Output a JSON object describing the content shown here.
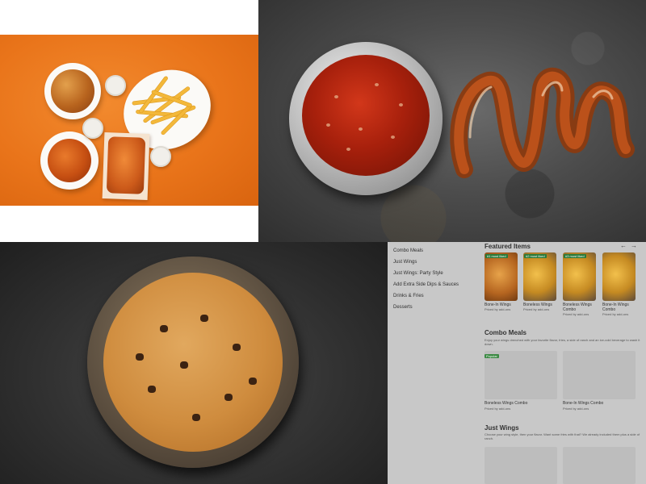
{
  "menu": {
    "categories": [
      "Combo Meals",
      "Just Wings",
      "Just Wings: Party Style",
      "Add Extra Side Dips & Sauces",
      "Drinks & Fries",
      "Desserts"
    ],
    "featured": {
      "title": "Featured Items",
      "prev_icon": "←",
      "next_icon": "→",
      "items": [
        {
          "badge": "#1 most liked",
          "name": "Bone-In Wings",
          "price": "Priced by add-ons"
        },
        {
          "badge": "#2 most liked",
          "name": "Boneless Wings",
          "price": "Priced by add-ons"
        },
        {
          "badge": "#3 most liked",
          "name": "Boneless Wings Combo",
          "price": "Priced by add-ons"
        },
        {
          "badge": "",
          "name": "Bone-In Wings Combo",
          "price": "Priced by add-ons"
        }
      ]
    },
    "combo": {
      "title": "Combo Meals",
      "description": "Enjoy your wings drenched with your favorite flavor, fries, a side of ranch and an ice-cold beverage to wash it down.",
      "items": [
        {
          "badge": "Popular",
          "name": "Boneless Wings Combo",
          "price": "Priced by add-ons"
        },
        {
          "badge": "",
          "name": "Bone-In Wings Combo",
          "price": "Priced by add-ons"
        }
      ]
    },
    "just_wings": {
      "title": "Just Wings",
      "description": "Choose your wing style, then your flavor. Want some fries with that? We already included them plus a side of ranch."
    }
  },
  "colors": {
    "orange_surface": "#e9741a",
    "slate": "#4c4c4c",
    "badge_green": "#2a7a3a",
    "menu_overlay": "#c8c8c8"
  }
}
